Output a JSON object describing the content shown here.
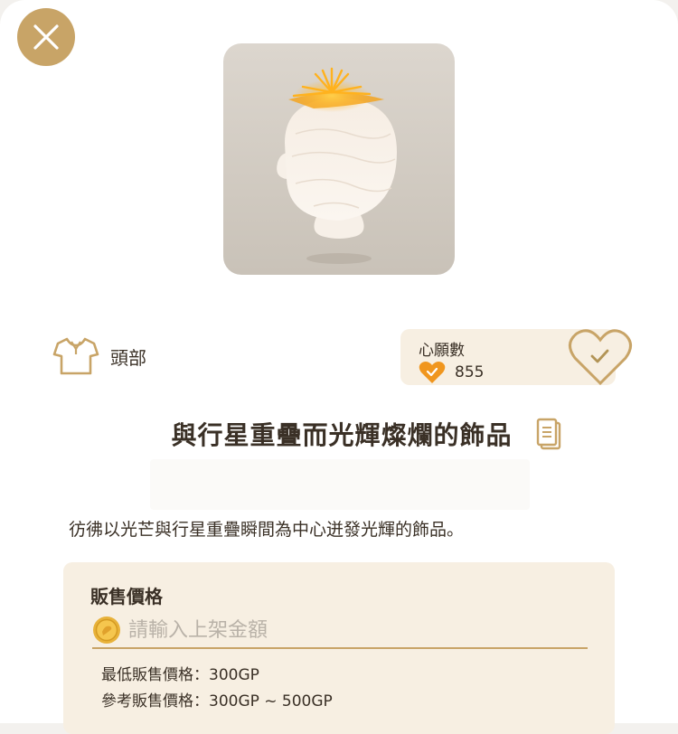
{
  "header": {
    "close_icon": "close-x-icon"
  },
  "item": {
    "image_icon": "head-accessory-preview",
    "title": "與行星重疊而光輝燦爛的飾品",
    "copy_icon": "copy-document-icon",
    "description": "彷彿以光芒與行星重疊瞬間為中心迸發光輝的飾品。"
  },
  "category": {
    "icon": "shirt-icon",
    "label": "頭部"
  },
  "wishlist": {
    "title": "心願數",
    "count": "855",
    "count_icon": "orange-heart-check-icon",
    "action_icon": "heart-check-button-icon"
  },
  "price": {
    "heading": "販售價格",
    "coin_icon": "gold-coin-icon",
    "placeholder": "請輸入上架金額",
    "min_price": "最低販售價格：300GP",
    "ref_price": "參考販售價格：300GP ~ 500GP"
  },
  "colors": {
    "accent_gold": "#c8a467",
    "card_beige": "#f7efe2",
    "heart_orange": "#f0961e"
  }
}
